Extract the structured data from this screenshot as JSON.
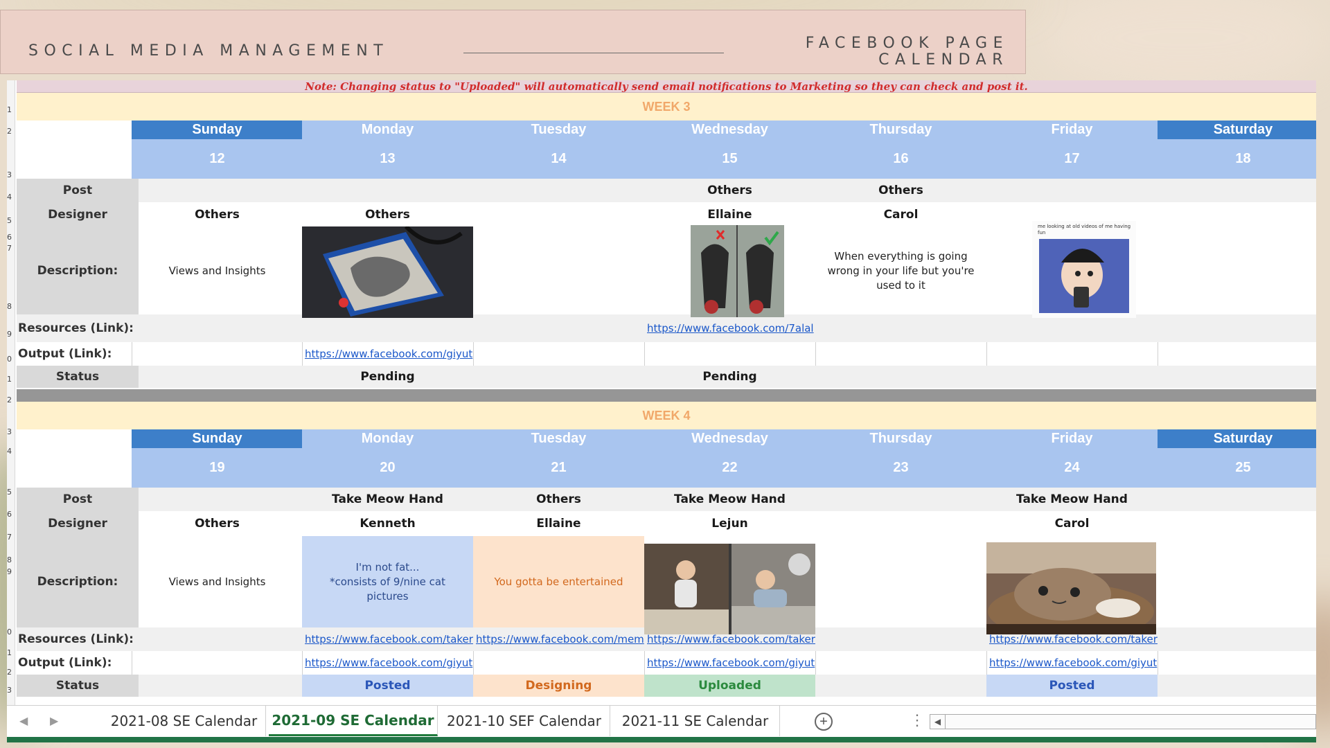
{
  "header": {
    "left_title": "SOCIAL MEDIA MANAGEMENT",
    "right_title_line1": "FACEBOOK PAGE",
    "right_title_line2": "CALENDAR"
  },
  "note": "Note: Changing status to \"Uploaded\" will automatically send email notifications to Marketing so they can check and post it.",
  "row_labels": {
    "post": "Post",
    "designer": "Designer",
    "description": "Description:",
    "resources": "Resources (Link):",
    "output": "Output (Link):",
    "status": "Status"
  },
  "weeks": [
    {
      "title": "WEEK 3",
      "days": [
        {
          "name": "Sunday",
          "num": "12",
          "post": "",
          "designer": "Others",
          "desc": "Views and Insights",
          "resource": "",
          "output": "",
          "status": ""
        },
        {
          "name": "Monday",
          "num": "13",
          "post": "",
          "designer": "Others",
          "desc": "",
          "resource": "",
          "output": "https://www.facebook.com/giyut",
          "status": "Pending"
        },
        {
          "name": "Tuesday",
          "num": "14",
          "post": "",
          "designer": "",
          "desc": "",
          "resource": "",
          "output": "",
          "status": ""
        },
        {
          "name": "Wednesday",
          "num": "15",
          "post": "Others",
          "designer": "Ellaine",
          "desc": "",
          "resource": "https://www.facebook.com/7alal",
          "output": "",
          "status": "Pending"
        },
        {
          "name": "Thursday",
          "num": "16",
          "post": "Others",
          "designer": "Carol",
          "desc": "When everything is going wrong in your life but you're used to it",
          "resource": "",
          "output": "",
          "status": ""
        },
        {
          "name": "Friday",
          "num": "17",
          "post": "",
          "designer": "",
          "desc": "",
          "resource": "",
          "output": "",
          "status": ""
        },
        {
          "name": "Saturday",
          "num": "18",
          "post": "",
          "designer": "",
          "desc": "",
          "resource": "",
          "output": "",
          "status": ""
        }
      ],
      "meme_caption": "me looking at old videos of me having fun"
    },
    {
      "title": "WEEK 4",
      "days": [
        {
          "name": "Sunday",
          "num": "19",
          "post": "",
          "designer": "Others",
          "desc": "Views and Insights",
          "resource": "",
          "output": "",
          "status": ""
        },
        {
          "name": "Monday",
          "num": "20",
          "post": "Take Meow Hand",
          "designer": "Kenneth",
          "desc": "I'm not fat...\n*consists of 9/nine cat pictures",
          "resource": "https://www.facebook.com/taker",
          "output": "https://www.facebook.com/giyut",
          "status": "Posted"
        },
        {
          "name": "Tuesday",
          "num": "21",
          "post": "Others",
          "designer": "Ellaine",
          "desc": "You gotta be entertained",
          "resource": "https://www.facebook.com/mem",
          "output": "",
          "status": "Designing"
        },
        {
          "name": "Wednesday",
          "num": "22",
          "post": "Take Meow Hand",
          "designer": "Lejun",
          "desc": "",
          "resource": "https://www.facebook.com/taker",
          "output": "https://www.facebook.com/giyut",
          "status": "Uploaded"
        },
        {
          "name": "Thursday",
          "num": "23",
          "post": "",
          "designer": "",
          "desc": "",
          "resource": "",
          "output": "",
          "status": ""
        },
        {
          "name": "Friday",
          "num": "24",
          "post": "Take Meow Hand",
          "designer": "Carol",
          "desc": "",
          "resource": "https://www.facebook.com/taker",
          "output": "https://www.facebook.com/giyut",
          "status": "Posted"
        },
        {
          "name": "Saturday",
          "num": "25",
          "post": "",
          "designer": "",
          "desc": "",
          "resource": "",
          "output": "",
          "status": ""
        }
      ]
    }
  ],
  "tabs": [
    {
      "label": "2021-08 SE Calendar",
      "active": false
    },
    {
      "label": "2021-09 SE Calendar",
      "active": true
    },
    {
      "label": "2021-10 SEF Calendar",
      "active": false
    },
    {
      "label": "2021-11 SE Calendar",
      "active": false
    }
  ],
  "colors": {
    "posted_bg": "#c7d8f5",
    "posted_text": "#2a56b8",
    "designing_bg": "#fde3cc",
    "designing_text": "#d2691e",
    "uploaded_bg": "#bfe3cb",
    "uploaded_text": "#2b8a3e",
    "pending_text": "#1a1a1a"
  }
}
